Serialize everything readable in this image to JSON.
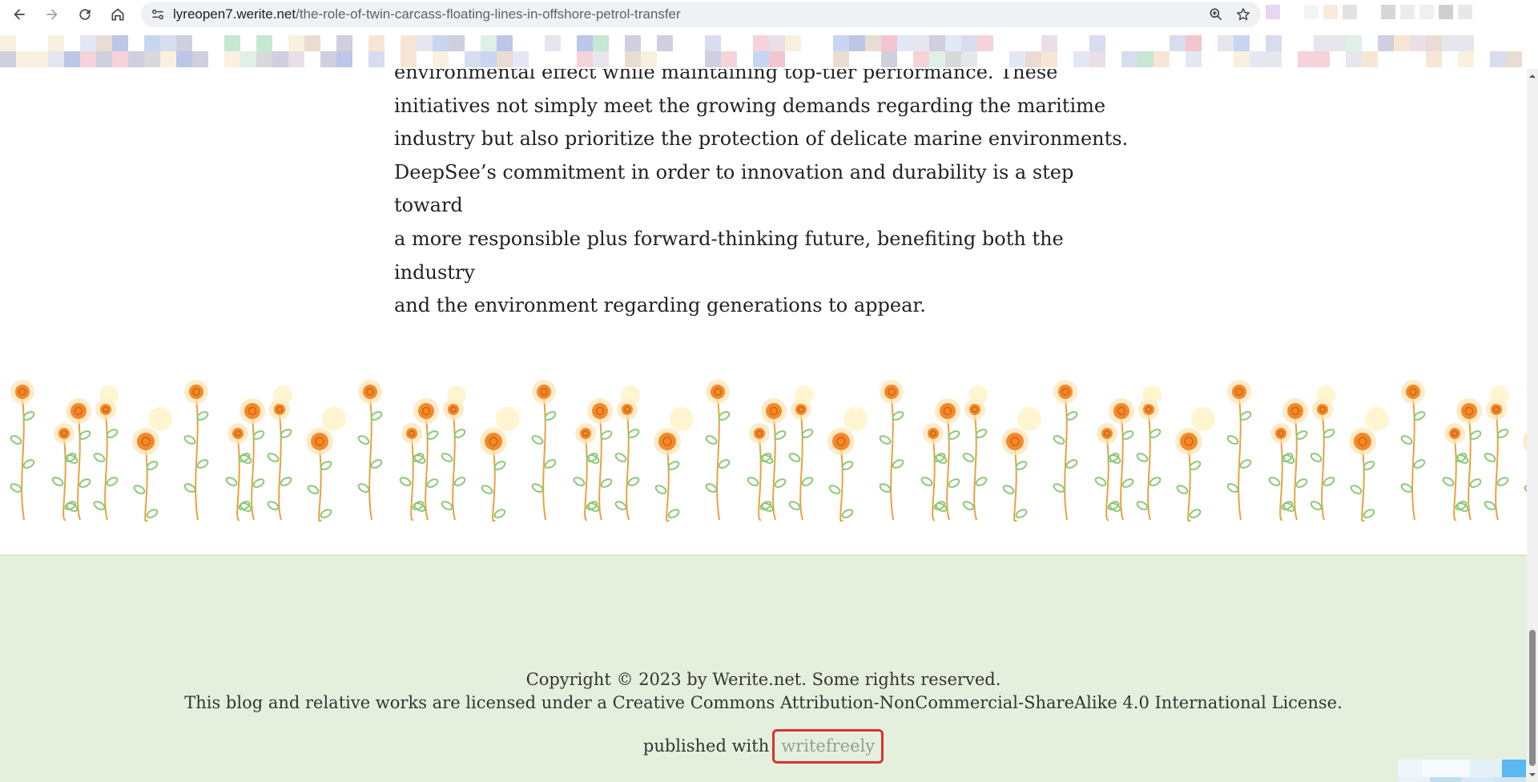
{
  "browser": {
    "url_host": "lyreopen7.werite.net",
    "url_path": "/the-role-of-twin-carcass-floating-lines-in-offshore-petrol-transfer"
  },
  "article": {
    "lines": [
      "environmental effect while maintaining top-tier performance. These",
      "initiatives not simply meet the growing demands regarding the maritime",
      "industry but also prioritize the protection of delicate marine environments.",
      "DeepSee’s commitment in order to innovation and durability is a step toward",
      "a more responsible plus forward-thinking future, benefiting both the industry",
      "and the environment regarding generations to appear."
    ]
  },
  "footer": {
    "copyright": "Copyright © 2023 by Werite.net. Some rights reserved.",
    "license": "This blog and relative works are licensed under a Creative Commons Attribution-NonCommercial-ShareAlike 4.0 International License.",
    "published_prefix": "published with",
    "writefreely_link": "writefreely"
  },
  "colors": {
    "footer_bg": "#e4f0dd",
    "highlight": "#d9322f",
    "flower": "#f28a2a",
    "stem": "#e8a33d",
    "leaf": "#8cc97a"
  },
  "icons": [
    "back-arrow-icon",
    "forward-arrow-icon",
    "reload-icon",
    "home-icon",
    "site-info-icon",
    "zoom-icon",
    "bookmark-star-icon"
  ]
}
